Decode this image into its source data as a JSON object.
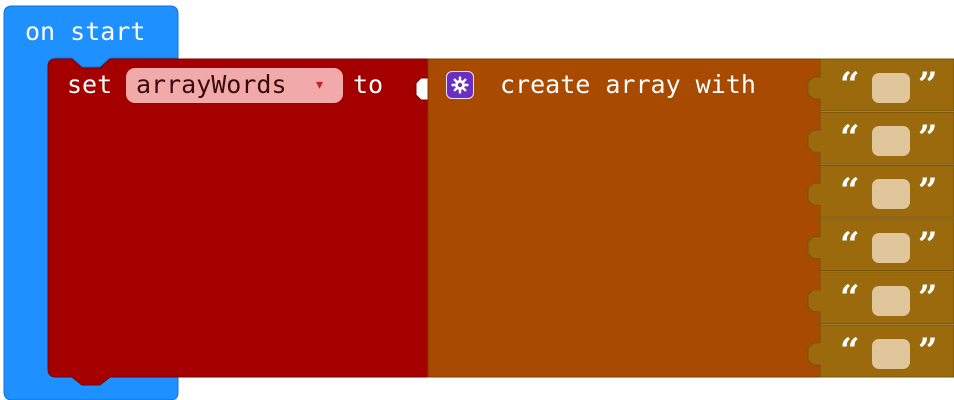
{
  "on_start_block": {
    "label": "on start",
    "color": "#1e90ff"
  },
  "set_block": {
    "set_label": "set",
    "variable_name": "arrayWords",
    "dropdown_arrow": "▾",
    "to_label": "to",
    "color": "#a50000"
  },
  "create_array_block": {
    "label": "create array with",
    "mutator_icon": "gear-icon",
    "color": "#a84b00"
  },
  "string_items": [
    {
      "open_quote": "“",
      "close_quote": "”",
      "value": ""
    },
    {
      "open_quote": "“",
      "close_quote": "”",
      "value": ""
    },
    {
      "open_quote": "“",
      "close_quote": "”",
      "value": ""
    },
    {
      "open_quote": "“",
      "close_quote": "”",
      "value": ""
    },
    {
      "open_quote": "“",
      "close_quote": "”",
      "value": ""
    },
    {
      "open_quote": "“",
      "close_quote": "”",
      "value": ""
    }
  ],
  "string_block_color": "#9a6a0c",
  "string_field_color": "#dfc79b"
}
